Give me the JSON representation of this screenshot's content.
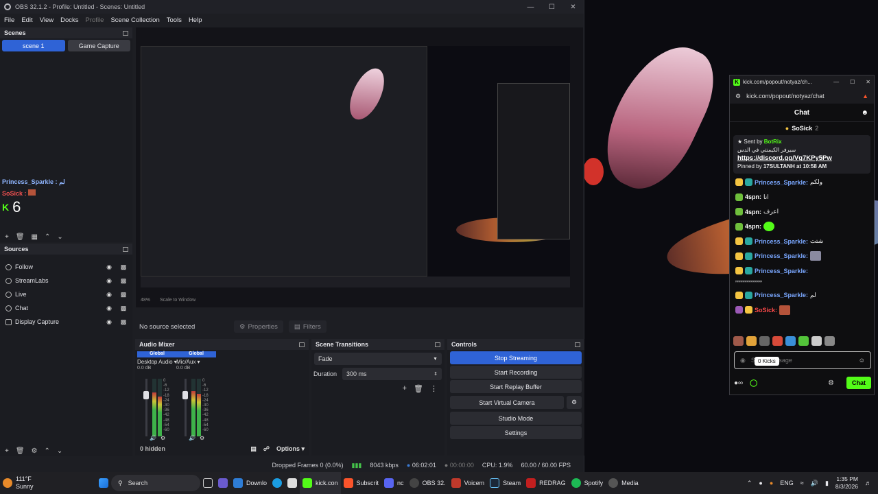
{
  "obs": {
    "title": "OBS 32.1.2 - Profile: Untitled - Scenes: Untitled",
    "menu": [
      "File",
      "Edit",
      "View",
      "Docks",
      "Profile",
      "Scene Collection",
      "Tools",
      "Help"
    ],
    "scenes_header": "Scenes",
    "scenes": [
      "scene 1",
      "Game Capture"
    ],
    "overlay": {
      "line1": "Princess_Sparkle : لم",
      "line2": "SoSick :",
      "count": "6"
    },
    "sources_header": "Sources",
    "sources": [
      {
        "name": "Follow",
        "icon": "globe-icon"
      },
      {
        "name": "StreamLabs",
        "icon": "globe-icon"
      },
      {
        "name": "Live",
        "icon": "globe-icon"
      },
      {
        "name": "Chat",
        "icon": "globe-icon"
      },
      {
        "name": "Display Capture",
        "icon": "monitor-icon"
      }
    ],
    "source_bar": {
      "status": "No source selected",
      "properties": "Properties",
      "filters": "Filters"
    },
    "mixer": {
      "header": "Audio Mixer",
      "channels": [
        {
          "badge": "Global",
          "name": "Desktop Audio",
          "db": "0.0 dB"
        },
        {
          "badge": "Global",
          "name": "Mic/Aux",
          "db": "0.0 dB"
        }
      ],
      "scale": [
        "0",
        "-6",
        "-12",
        "-18",
        "-24",
        "-30",
        "-36",
        "-42",
        "-48",
        "-54",
        "-60"
      ],
      "hidden": "0 hidden",
      "options": "Options"
    },
    "transitions": {
      "header": "Scene Transitions",
      "type": "Fade",
      "duration_label": "Duration",
      "duration": "300 ms"
    },
    "controls": {
      "header": "Controls",
      "buttons": [
        "Stop Streaming",
        "Start Recording",
        "Start Replay Buffer",
        "Start Virtual Camera",
        "Studio Mode",
        "Settings"
      ]
    },
    "status": {
      "dropped": "Dropped Frames 0 (0.0%)",
      "kbps": "8043 kbps",
      "stream_time": "06:02:01",
      "rec_time": "00:00:00",
      "cpu": "CPU: 1.9%",
      "fps": "60.00 / 60.00 FPS"
    },
    "preview_zoom": {
      "zoom": "48%",
      "mode": "Scale to Window"
    }
  },
  "kick": {
    "tab_title": "kick.com/popout/notyaz/ch...",
    "url": "kick.com/popout/notyaz/chat",
    "chat_title": "Chat",
    "top_gifter": {
      "name": "SoSick",
      "count": "2"
    },
    "pinned": {
      "sent_by_label": "Sent by",
      "sender": "BotRix",
      "text": "سيرفر الكيمنتي في الدس",
      "link": "https://discord.gg/Vg7KPy5Pw",
      "pinned_by_label": "Pinned by",
      "pinned_by": "17SULTANH at 10:58 AM"
    },
    "messages": [
      {
        "user": "Princess_Sparkle:",
        "text": "ولكم",
        "cls": "u-blue"
      },
      {
        "user": "4spn:",
        "text": "انا",
        "cls": "u-white"
      },
      {
        "user": "4spn:",
        "text": "اعرف",
        "cls": "u-white"
      },
      {
        "user": "4spn:",
        "text": "",
        "cls": "u-white"
      },
      {
        "user": "Princess_Sparkle:",
        "text": "شتت",
        "cls": "u-blue"
      },
      {
        "user": "Princess_Sparkle:",
        "text": "",
        "cls": "u-blue"
      },
      {
        "user": "Princess_Sparkle:",
        "text": "",
        "cls": "u-blue"
      },
      {
        "user": "",
        "text": "ˮˮˮˮˮˮˮˮˮˮˮˮˮ",
        "cls": "u-white"
      },
      {
        "user": "Princess_Sparkle:",
        "text": "لم",
        "cls": "u-blue"
      },
      {
        "user": "SoSick:",
        "text": "",
        "cls": "u-red"
      }
    ],
    "send_placeholder": "Send message",
    "kicks_tooltip": "0 Kicks",
    "chat_button": "Chat"
  },
  "taskbar": {
    "weather": {
      "temp": "111°F",
      "cond": "Sunny"
    },
    "search": "Search",
    "apps": [
      {
        "label": "Downlo",
        "icon": "download-icon",
        "color": "#2e7dd6"
      },
      {
        "label": "kick.con",
        "icon": "kick-icon",
        "color": "#53fc18"
      },
      {
        "label": "Subscrit",
        "icon": "brave-icon",
        "color": "#fb542b"
      },
      {
        "label": "nc",
        "icon": "discord-icon",
        "color": "#5865f2"
      },
      {
        "label": "OBS 32.",
        "icon": "obs-icon",
        "color": "#444"
      },
      {
        "label": "Voicem",
        "icon": "voicemeeter-icon",
        "color": "#c0392b"
      },
      {
        "label": "Steam",
        "icon": "steam-icon",
        "color": "#1b2838"
      },
      {
        "label": "REDRAG",
        "icon": "redragon-icon",
        "color": "#c21f1f"
      },
      {
        "label": "Spotify",
        "icon": "spotify-icon",
        "color": "#1db954"
      },
      {
        "label": "Media",
        "icon": "media-icon",
        "color": "#555"
      }
    ],
    "lang": "ENG",
    "time": "1:35 PM",
    "date": "8/3/2026"
  }
}
